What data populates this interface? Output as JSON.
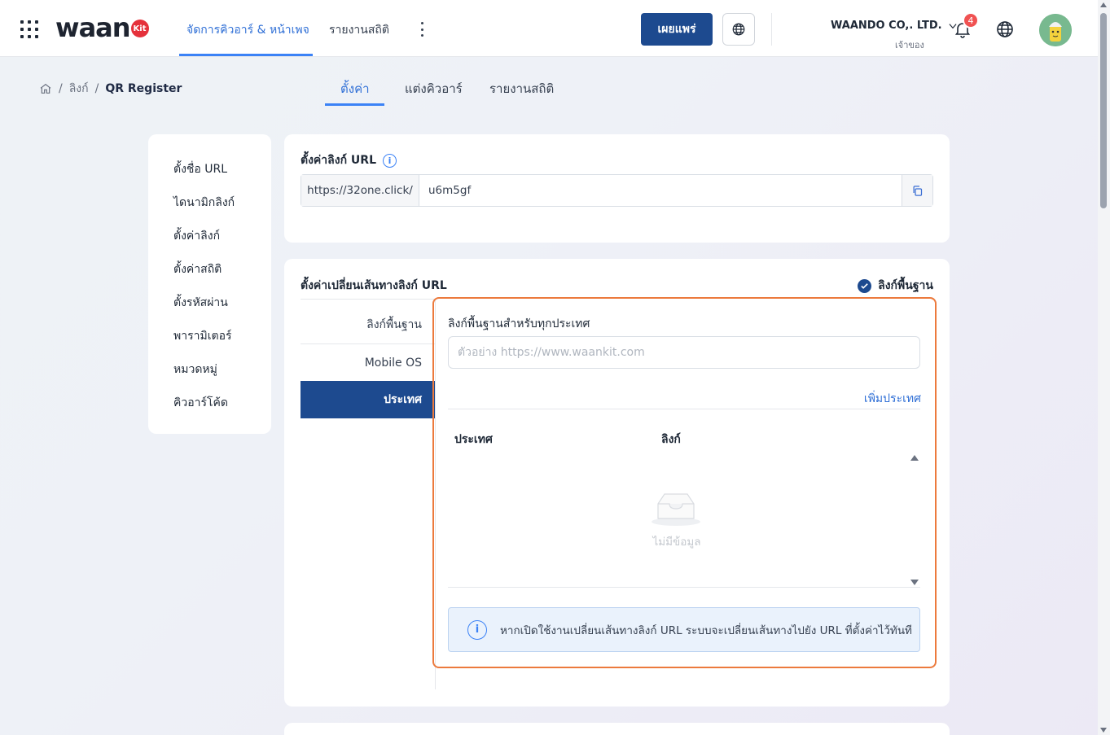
{
  "header": {
    "logo_text": "waan",
    "logo_badge": "Kit",
    "nav": [
      {
        "label": "จัดการคิวอาร์ & หน้าเพจ"
      },
      {
        "label": "รายงานสถิติ"
      }
    ],
    "publish_label": "เผยแพร่",
    "company_name": "WAANDO CO,. LTD.",
    "company_role": "เจ้าของ",
    "notification_count": "4"
  },
  "breadcrumb": {
    "items": [
      "ลิงก์",
      "QR Register"
    ]
  },
  "page_tabs": [
    {
      "label": "ตั้งค่า",
      "active": true
    },
    {
      "label": "แต่งคิวอาร์",
      "active": false
    },
    {
      "label": "รายงานสถิติ",
      "active": false
    }
  ],
  "side_menu": [
    {
      "label": "ตั้งชื่อ URL"
    },
    {
      "label": "ไดนามิกลิงก์"
    },
    {
      "label": "ตั้งค่าลิงก์"
    },
    {
      "label": "ตั้งค่าสถิติ"
    },
    {
      "label": "ตั้งรหัสผ่าน"
    },
    {
      "label": "พารามิเตอร์"
    },
    {
      "label": "หมวดหมู่"
    },
    {
      "label": "คิวอาร์โค้ด"
    }
  ],
  "url_card": {
    "title": "ตั้งค่าลิงก์ URL",
    "prefix": "https://32one.click/",
    "slug": "u6m5gf"
  },
  "redirect_card": {
    "title": "ตั้งค่าเปลี่ยนเส้นทางลิงก์ URL",
    "checkbox_label": "ลิงก์พื้นฐาน",
    "tabs": [
      {
        "label": "ลิงก์พื้นฐาน",
        "active": false
      },
      {
        "label": "Mobile OS",
        "active": false
      },
      {
        "label": "ประเทศ",
        "active": true
      }
    ],
    "panel": {
      "label": "ลิงก์พื้นฐานสำหรับทุกประเทศ",
      "placeholder": "ตัวอย่าง https://www.waankit.com",
      "add_country": "เพิ่มประเทศ",
      "columns": [
        "ประเทศ",
        "ลิงก์"
      ],
      "empty_text": "ไม่มีข้อมูล",
      "alert": "หากเปิดใช้งานเปลี่ยนเส้นทางลิงก์ URL ระบบจะเปลี่ยนเส้นทางไปยัง URL ที่ตั้งค่าไว้ทันที"
    }
  },
  "colors": {
    "primary": "#1d4a8f",
    "accent": "#3b82f6",
    "highlight": "#ec7a3d",
    "badge": "#f05252"
  }
}
